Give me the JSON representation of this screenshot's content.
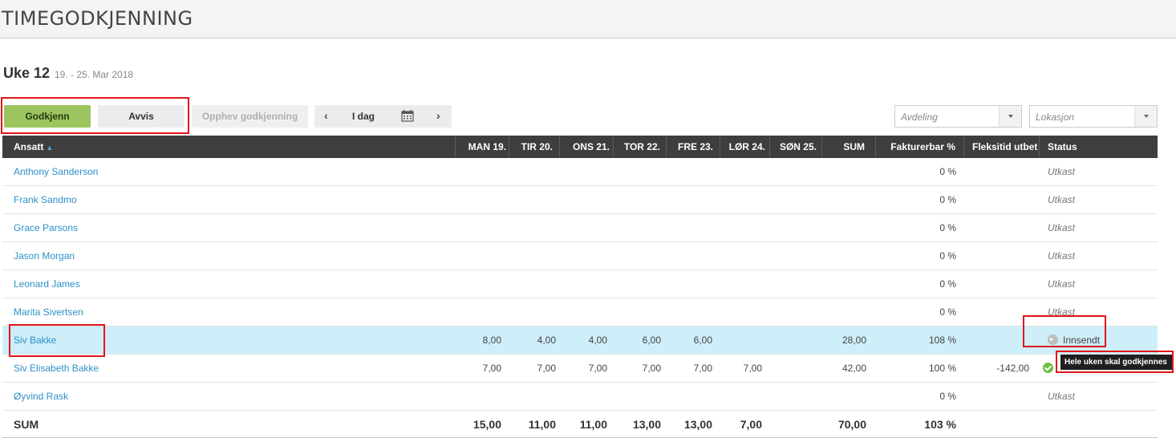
{
  "page": {
    "title": "TIMEGODKJENNING"
  },
  "week": {
    "label": "Uke 12",
    "range": "19. - 25. Mar 2018"
  },
  "toolbar": {
    "approve_label": "Godkjenn",
    "reject_label": "Avvis",
    "undo_label": "Opphev godkjenning",
    "prev_label": "‹",
    "today_label": "I dag",
    "next_label": "›",
    "department_placeholder": "Avdeling",
    "location_placeholder": "Lokasjon"
  },
  "table": {
    "columns": {
      "employee": "Ansatt",
      "mon": "MAN 19.",
      "tue": "TIR 20.",
      "wed": "ONS 21.",
      "thu": "TOR 22.",
      "fri": "FRE 23.",
      "sat": "LØR 24.",
      "sun": "SØN 25.",
      "sum": "SUM",
      "billable": "Fakturerbar %",
      "flex": "Fleksitid utbet",
      "status": "Status"
    },
    "rows": [
      {
        "name": "Anthony Sanderson",
        "mon": "",
        "tue": "",
        "wed": "",
        "thu": "",
        "fri": "",
        "sat": "",
        "sun": "",
        "sum": "",
        "billable": "0 %",
        "flex": "",
        "status": "Utkast"
      },
      {
        "name": "Frank Sandmo",
        "mon": "",
        "tue": "",
        "wed": "",
        "thu": "",
        "fri": "",
        "sat": "",
        "sun": "",
        "sum": "",
        "billable": "0 %",
        "flex": "",
        "status": "Utkast"
      },
      {
        "name": "Grace Parsons",
        "mon": "",
        "tue": "",
        "wed": "",
        "thu": "",
        "fri": "",
        "sat": "",
        "sun": "",
        "sum": "",
        "billable": "0 %",
        "flex": "",
        "status": "Utkast"
      },
      {
        "name": "Jason Morgan",
        "mon": "",
        "tue": "",
        "wed": "",
        "thu": "",
        "fri": "",
        "sat": "",
        "sun": "",
        "sum": "",
        "billable": "0 %",
        "flex": "",
        "status": "Utkast"
      },
      {
        "name": "Leonard James",
        "mon": "",
        "tue": "",
        "wed": "",
        "thu": "",
        "fri": "",
        "sat": "",
        "sun": "",
        "sum": "",
        "billable": "0 %",
        "flex": "",
        "status": "Utkast"
      },
      {
        "name": "Marita Sivertsen",
        "mon": "",
        "tue": "",
        "wed": "",
        "thu": "",
        "fri": "",
        "sat": "",
        "sun": "",
        "sum": "",
        "billable": "0 %",
        "flex": "",
        "status": "Utkast"
      },
      {
        "name": "Siv Bakke",
        "mon": "8,00",
        "tue": "4,00",
        "wed": "4,00",
        "thu": "6,00",
        "fri": "6,00",
        "sat": "",
        "sun": "",
        "sum": "28,00",
        "billable": "108 %",
        "flex": "",
        "status": "Innsendt",
        "icon": "arrow-right-circle-icon"
      },
      {
        "name": "Siv Elisabeth Bakke",
        "mon": "7,00",
        "tue": "7,00",
        "wed": "7,00",
        "thu": "7,00",
        "fri": "7,00",
        "sat": "7,00",
        "sun": "",
        "sum": "42,00",
        "billable": "100 %",
        "flex": "-142,00",
        "status": "",
        "icon": "check-circle-icon"
      },
      {
        "name": "Øyvind Rask",
        "mon": "",
        "tue": "",
        "wed": "",
        "thu": "",
        "fri": "",
        "sat": "",
        "sun": "",
        "sum": "",
        "billable": "0 %",
        "flex": "",
        "status": "Utkast"
      }
    ],
    "totals": {
      "label": "SUM",
      "mon": "15,00",
      "tue": "11,00",
      "wed": "11,00",
      "thu": "13,00",
      "fri": "13,00",
      "sat": "7,00",
      "sun": "",
      "sum": "70,00",
      "billable": "103 %"
    }
  },
  "tooltip": {
    "text": "Hele uken skal godkjennes"
  },
  "colors": {
    "accent": "#9cc55f",
    "header": "#3e3e3e",
    "link": "#2e8fc9",
    "highlight_row": "#ceeef9",
    "annotation": "#e0161b"
  }
}
